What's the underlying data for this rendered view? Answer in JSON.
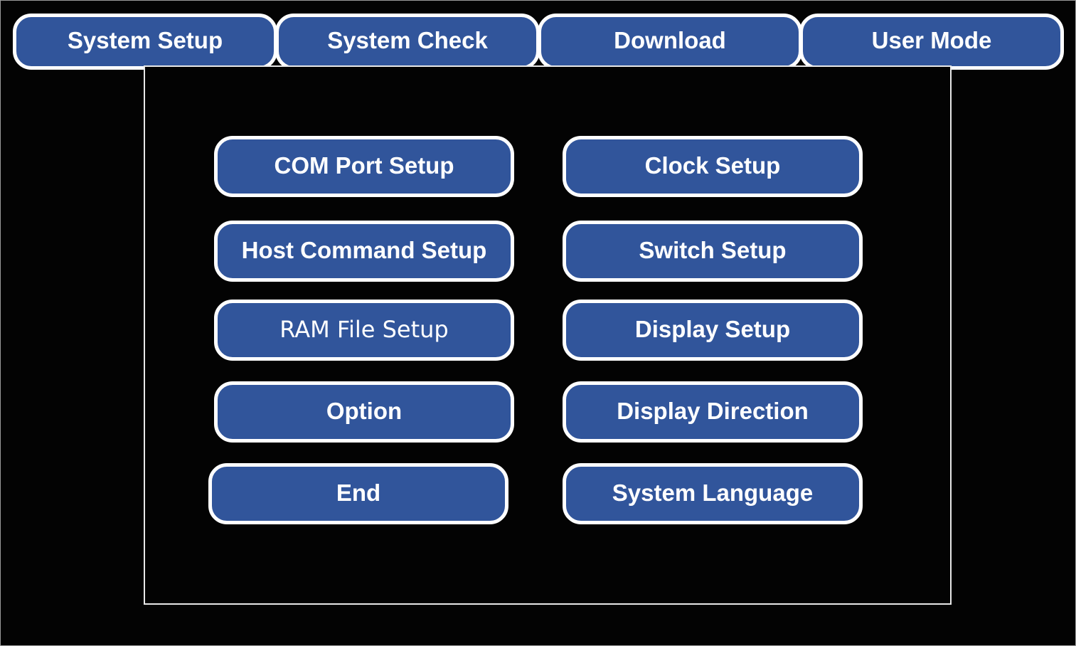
{
  "colors": {
    "button_fill": "#31559b",
    "button_border": "#ffffff",
    "background": "#030303",
    "text": "#ffffff"
  },
  "tabs": [
    {
      "label": "System Setup"
    },
    {
      "label": "System Check"
    },
    {
      "label": "Download"
    },
    {
      "label": "User Mode"
    }
  ],
  "menu": {
    "left": [
      {
        "label": "COM Port Setup"
      },
      {
        "label": "Host Command Setup"
      },
      {
        "label": "RAM File Setup"
      },
      {
        "label": "Option"
      },
      {
        "label": "End"
      }
    ],
    "right": [
      {
        "label": "Clock Setup"
      },
      {
        "label": "Switch Setup"
      },
      {
        "label": "Display Setup"
      },
      {
        "label": "Display Direction"
      },
      {
        "label": "System Language"
      }
    ]
  }
}
